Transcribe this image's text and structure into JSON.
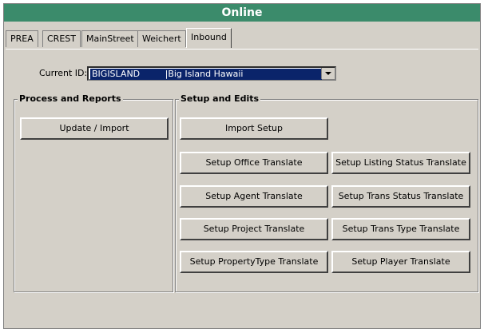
{
  "window": {
    "title": "Online"
  },
  "tabs": [
    "PREA",
    "CREST",
    "MainStreet",
    "Weichert",
    "Inbound"
  ],
  "active_tab": "Inbound",
  "current_id": {
    "label": "Current ID:",
    "value": "BIGISLAND         |Big Island Hawaii"
  },
  "process_group": {
    "title": "Process and Reports",
    "buttons": [
      "Update / Import"
    ]
  },
  "setup_group": {
    "title": "Setup and Edits",
    "buttons": [
      "Import Setup",
      "Setup Office Translate",
      "Setup Listing Status Translate",
      "Setup Agent Translate",
      "Setup Trans Status Translate",
      "Setup Project Translate",
      "Setup Trans Type Translate",
      "Setup PropertyType Translate",
      "Setup Player Translate"
    ]
  },
  "icons": {
    "combo_dropdown": "chevron-down-icon"
  }
}
